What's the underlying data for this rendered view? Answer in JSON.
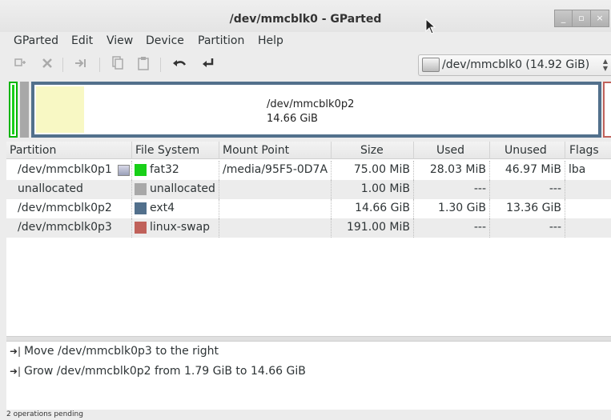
{
  "window": {
    "title": "/dev/mmcblk0 - GParted"
  },
  "menubar": {
    "items": [
      "GParted",
      "Edit",
      "View",
      "Device",
      "Partition",
      "Help"
    ]
  },
  "device_selector": {
    "value": "/dev/mmcblk0  (14.92 GiB)"
  },
  "disk_map": {
    "selected_name": "/dev/mmcblk0p2",
    "selected_size": "14.66 GiB"
  },
  "table": {
    "headers": [
      "Partition",
      "File System",
      "Mount Point",
      "Size",
      "Used",
      "Unused",
      "Flags"
    ],
    "rows": [
      {
        "partition": "/dev/mmcblk0p1",
        "fs": "fat32",
        "fs_color": "#18d018",
        "mount": "/media/95F5-0D7A",
        "size": "75.00 MiB",
        "used": "28.03 MiB",
        "unused": "46.97 MiB",
        "flags": "lba"
      },
      {
        "partition": "unallocated",
        "fs": "unallocated",
        "fs_color": "#a8a8a8",
        "mount": "",
        "size": "1.00 MiB",
        "used": "---",
        "unused": "---",
        "flags": ""
      },
      {
        "partition": "/dev/mmcblk0p2",
        "fs": "ext4",
        "fs_color": "#52708c",
        "mount": "",
        "size": "14.66 GiB",
        "used": "1.30 GiB",
        "unused": "13.36 GiB",
        "flags": ""
      },
      {
        "partition": "/dev/mmcblk0p3",
        "fs": "linux-swap",
        "fs_color": "#c0615a",
        "mount": "",
        "size": "191.00 MiB",
        "used": "---",
        "unused": "---",
        "flags": ""
      }
    ]
  },
  "operations": [
    "Move /dev/mmcblk0p3 to the right",
    "Grow /dev/mmcblk0p2 from 1.79 GiB to 14.66 GiB"
  ],
  "status": {
    "text": "2 operations pending"
  }
}
